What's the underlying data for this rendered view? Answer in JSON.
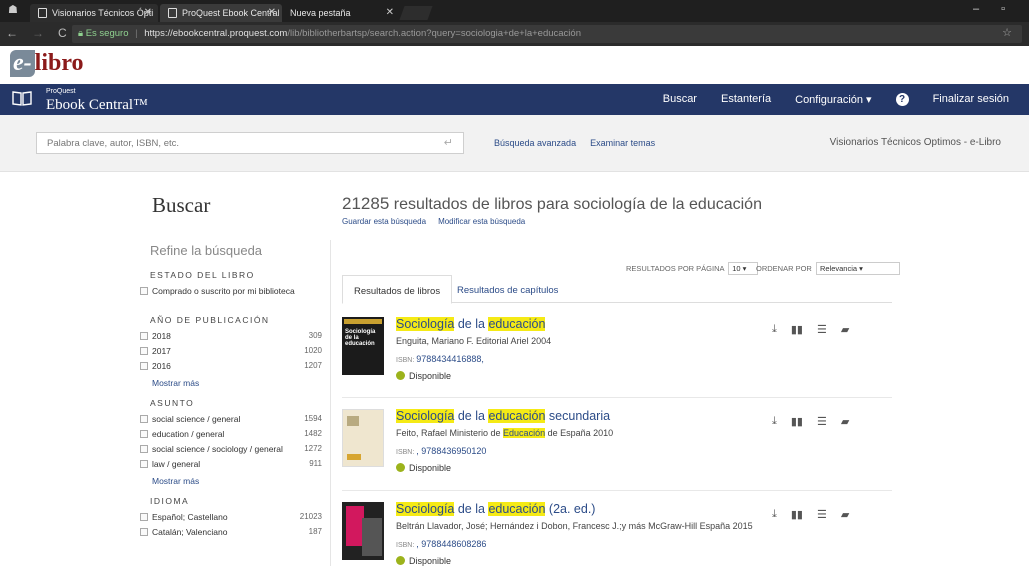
{
  "browser": {
    "tabs": [
      {
        "label": "Visionarios Técnicos Ópti"
      },
      {
        "label": "ProQuest Ebook Central"
      },
      {
        "label": "Nueva pestaña"
      }
    ],
    "secure_label": "Es seguro",
    "url_host": "https://ebookcentral.proquest.com",
    "url_path": "/lib/bibliotherbartsp/search.action?query=sociologia+de+la+educación"
  },
  "site": {
    "logo": "libro",
    "logo_prefix": "e-",
    "brand_small": "ProQuest",
    "brand_big": "Ebook Central™"
  },
  "topnav": {
    "buscar": "Buscar",
    "estanteria": "Estantería",
    "config": "Configuración ▾",
    "help": "?",
    "logout": "Finalizar sesión"
  },
  "search": {
    "placeholder": "Palabra clave, autor, ISBN, etc.",
    "advanced": "Búsqueda avanzada",
    "browse": "Examinar temas",
    "institution": "Visionarios Técnicos Optimos - e-Libro"
  },
  "main": {
    "title": "Buscar",
    "count": "21285",
    "results_text": "resultados de libros para sociología de la educación",
    "save": "Guardar esta búsqueda",
    "modify": "Modificar esta búsqueda"
  },
  "sidebar": {
    "refine": "Refine la búsqueda",
    "estado_title": "ESTADO DEL LIBRO",
    "estado_item": "Comprado o suscrito por mi biblioteca",
    "anio_title": "AÑO DE PUBLICACIÓN",
    "anio_items": [
      {
        "label": "2018",
        "count": "309"
      },
      {
        "label": "2017",
        "count": "1020"
      },
      {
        "label": "2016",
        "count": "1207"
      }
    ],
    "more1": "Mostrar más",
    "asunto_title": "ASUNTO",
    "asunto_items": [
      {
        "label": "social science / general",
        "count": "1594"
      },
      {
        "label": "education / general",
        "count": "1482"
      },
      {
        "label": "social science / sociology / general",
        "count": "1272"
      },
      {
        "label": "law / general",
        "count": "911"
      }
    ],
    "more2": "Mostrar más",
    "idioma_title": "IDIOMA",
    "idioma_items": [
      {
        "label": "Español; Castellano",
        "count": "21023"
      },
      {
        "label": "Catalán; Valenciano",
        "count": "187"
      }
    ]
  },
  "controls": {
    "perpage_label": "RESULTADOS POR PÁGINA",
    "perpage_value": "10 ▾",
    "sort_label": "ORDENAR POR",
    "sort_value": "Relevancia ▾"
  },
  "result_tabs": {
    "books": "Resultados de libros",
    "chapters": "Resultados de capítulos"
  },
  "books": [
    {
      "t1": "Sociología",
      "t2": " de la ",
      "t3": "educación",
      "t4": "",
      "author": "Enguita, Mariano F.  Editorial Ariel  2004",
      "isbn_label": "ISBN:",
      "isbn": "9788434416888,",
      "status": "Disponible"
    },
    {
      "t1": "Sociología",
      "t2": " de la ",
      "t3": "educación",
      "t4": " secundaria",
      "author_a": "Feito, Rafael  Ministerio de ",
      "author_hl": "Educación",
      "author_b": " de España  2010",
      "isbn_label": "ISBN:",
      "isbn": ", 9788436950120",
      "status": "Disponible"
    },
    {
      "t1": "Sociología",
      "t2": " de la ",
      "t3": "educación",
      "t4": " (2a. ed.)",
      "author": "Beltrán Llavador, José; Hernández i Dobon, Francesc J.;y más  McGraw-Hill España  2015",
      "isbn_label": "ISBN:",
      "isbn": ", 9788448608286",
      "status": "Disponible"
    }
  ],
  "cover1": {
    "title": "Sociología de la educación"
  }
}
